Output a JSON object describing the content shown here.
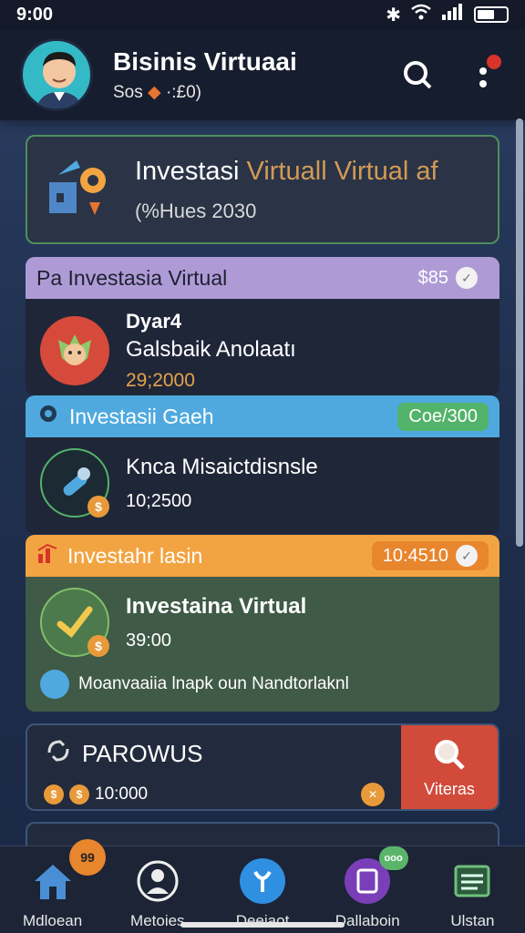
{
  "status": {
    "time": "9:00"
  },
  "header": {
    "title": "Bisinis Virtuaai",
    "sub_prefix": "Sos",
    "sub_suffix": "·:£0)"
  },
  "hero": {
    "title_white": "Investasi",
    "title_accent": "Virtuall Virtual af",
    "subtitle": "(%Hues 2030"
  },
  "cards": [
    {
      "head": "Pa Investasia Virtual",
      "pill": "$85",
      "l1": "Dyar4",
      "l2": "Galsbaik Anolaatı",
      "l3": "29;2000",
      "color": "#ae9bd6"
    },
    {
      "head": "Investasii Gaeh",
      "pill": "Coe/300",
      "l1": "Knca Misaictdisnsle",
      "l2": "10;2500",
      "color": "#4fa9df"
    },
    {
      "head": "Investahr lasin",
      "pill": "10:4510",
      "l1": "Investaina Virtual",
      "l2": "39:00",
      "footer": "Moanvaaiia lnapk oun Nandtorlaknl",
      "color": "#f2a443"
    }
  ],
  "search_card": {
    "title": "PAROWUS",
    "amount": "10:000",
    "action": "Viteras"
  },
  "nav": [
    {
      "label": "Mdloean",
      "badge": "99"
    },
    {
      "label": "Metoies"
    },
    {
      "label": "Deeiaot"
    },
    {
      "label": "Dallaboin",
      "badge": "ooo"
    },
    {
      "label": "Ulstan"
    }
  ]
}
